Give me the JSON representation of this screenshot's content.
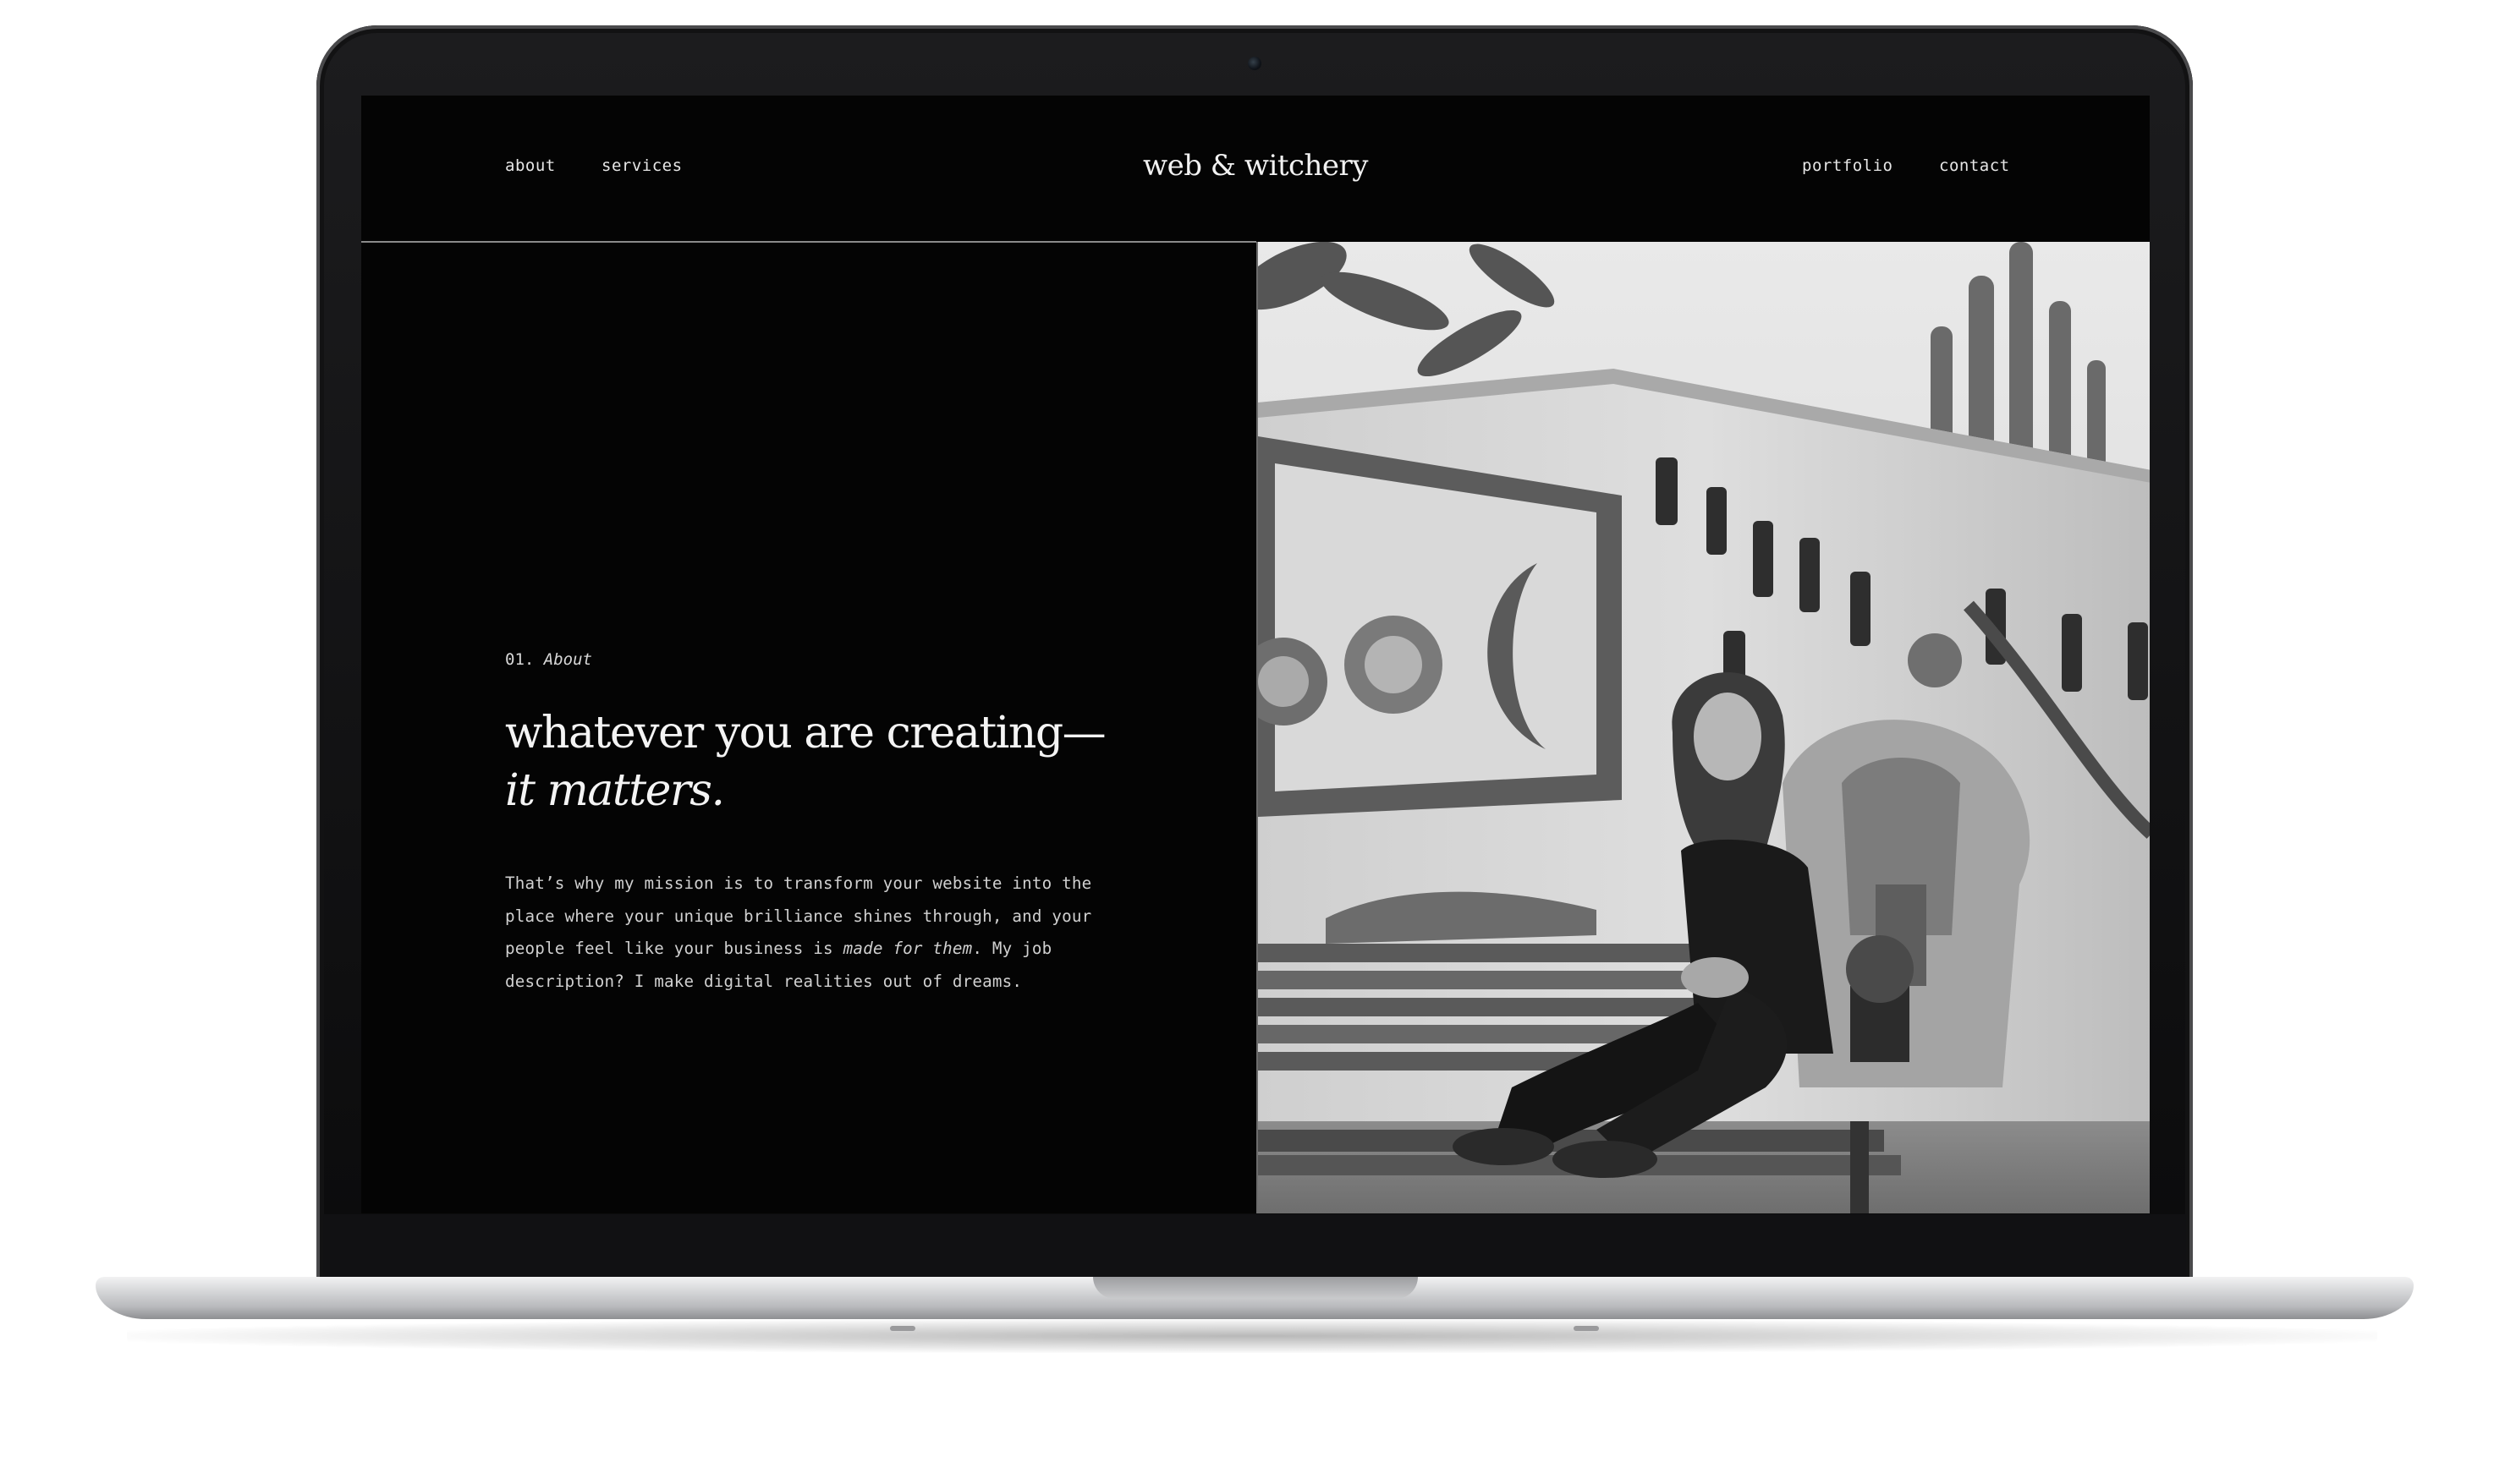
{
  "nav": {
    "left_links": [
      "about",
      "services"
    ],
    "brand": "web & witchery",
    "right_links": [
      "portfolio",
      "contact"
    ]
  },
  "about": {
    "section_number": "01.",
    "section_label": "About",
    "headline_plain": "whatever you are creating—",
    "headline_italic": "it matters.",
    "body_before": "That’s why my mission is to transform your website into the place where your unique brilliance shines through, and your people feel like your business is ",
    "body_italic": "made for them",
    "body_after": ". My job description? I make digital realities out of dreams."
  },
  "photo": {
    "subject": "black-and-white photo of a woman seated on a bench before a decorated garden wall with cacti, suns, a moon and hanging bottles"
  },
  "colors": {
    "screen_background": "#040404",
    "text_primary": "#f4f4f4",
    "text_secondary": "#d0d0d0",
    "divider": "#8a8a8a",
    "laptop_bezel": "#111113",
    "laptop_base": "#c8c9cb"
  }
}
